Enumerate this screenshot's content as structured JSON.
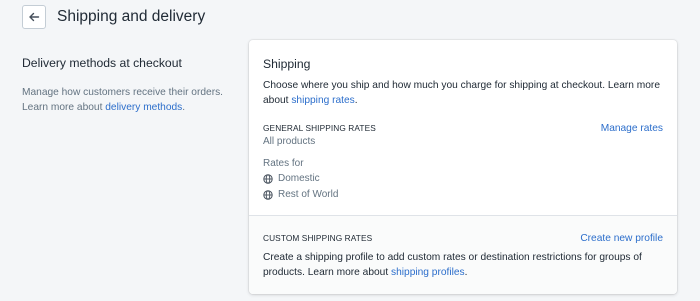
{
  "header": {
    "title": "Shipping and delivery",
    "back_icon": "arrow-left-icon"
  },
  "left": {
    "title": "Delivery methods at checkout",
    "desc_line1": "Manage how customers receive their orders.",
    "desc_line2_prefix": "Learn more about ",
    "desc_link": "delivery methods",
    "desc_suffix": "."
  },
  "card": {
    "title": "Shipping",
    "desc_line1": "Choose where you ship and how much you charge for shipping at checkout. Learn more",
    "desc_line2_prefix": "about ",
    "desc_link": "shipping rates",
    "desc_suffix": ".",
    "general": {
      "heading": "GENERAL SHIPPING RATES",
      "action": "Manage rates",
      "subtitle": "All products",
      "rates_for": "Rates for",
      "zones": [
        {
          "label": "Domestic",
          "icon": "globe-icon"
        },
        {
          "label": "Rest of World",
          "icon": "globe-icon"
        }
      ]
    },
    "custom": {
      "heading": "CUSTOM SHIPPING RATES",
      "action": "Create new profile",
      "desc_line1": "Create a shipping profile to add custom rates or destination restrictions for groups of",
      "desc_line2_prefix": "products. Learn more about ",
      "desc_link": "shipping profiles",
      "desc_suffix": "."
    }
  },
  "colors": {
    "background": "#f4f6f8",
    "link": "#2c6ecb",
    "text": "#212b36",
    "muted": "#637381"
  }
}
